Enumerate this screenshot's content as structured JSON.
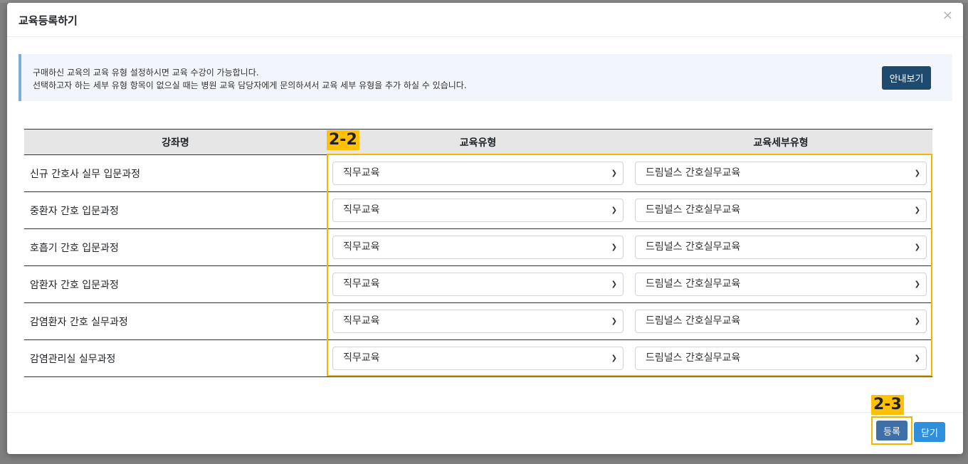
{
  "modal": {
    "title": "교육등록하기",
    "close_glyph": "×"
  },
  "notice": {
    "line1": "구매하신 교육의 교육 유형 설정하시면 교육 수강이 가능합니다.",
    "line2": "선택하고자 하는 세부 유형 항목이 없으실 때는 병원 교육 담당자에게 문의하셔서 교육 세부 유형을 추가 하실 수 있습니다.",
    "guide_button": "안내보기"
  },
  "table": {
    "headers": [
      "강좌명",
      "교육유형",
      "교육세부유형"
    ],
    "rows": [
      {
        "course": "신규 간호사 실무 입문과정",
        "type": "직무교육",
        "subtype": "드림널스 간호실무교육"
      },
      {
        "course": "중환자 간호 입문과정",
        "type": "직무교육",
        "subtype": "드림널스 간호실무교육"
      },
      {
        "course": "호흡기 간호 입문과정",
        "type": "직무교육",
        "subtype": "드림널스 간호실무교육"
      },
      {
        "course": "암환자 간호 입문과정",
        "type": "직무교육",
        "subtype": "드림널스 간호실무교육"
      },
      {
        "course": "감염환자 간호 실무과정",
        "type": "직무교육",
        "subtype": "드림널스 간호실무교육"
      },
      {
        "course": "감염관리실 실무과정",
        "type": "직무교육",
        "subtype": "드림널스 간호실무교육"
      }
    ]
  },
  "annotations": {
    "tag_select_area": "2-2",
    "tag_register": "2-3"
  },
  "footer": {
    "register_button": "등록",
    "close_button": "닫기"
  },
  "colors": {
    "highlight": "#f5b400",
    "guide_button": "#1e4a6f",
    "register_button": "#3f6fa8",
    "close_button": "#2f8fdb"
  }
}
